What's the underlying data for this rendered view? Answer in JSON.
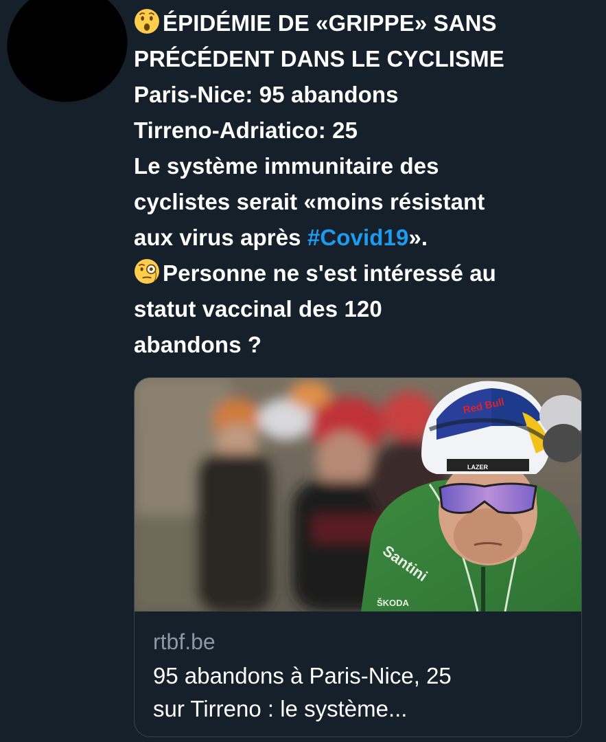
{
  "tweet": {
    "lines": [
      {
        "emoji": "hushed-face-emoji",
        "text": "ÉPIDÉMIE DE «GRIPPE» SANS"
      },
      {
        "text": "PRÉCÉDENT DANS LE CYCLISME"
      },
      {
        "text": "Paris-Nice: 95 abandons"
      },
      {
        "text": "Tirreno-Adriatico: 25"
      },
      {
        "text": "Le système immunitaire des"
      },
      {
        "text": "cyclistes serait «moins résistant"
      },
      {
        "text_before": "aux virus après ",
        "hashtag": "#Covid19",
        "text_after": "»."
      },
      {
        "emoji": "face-with-monocle-emoji",
        "text": "Personne ne s'est intéressé au"
      },
      {
        "text": "statut vaccinal des 120"
      },
      {
        "text": "abandons ?"
      }
    ]
  },
  "card": {
    "domain": "rtbf.be",
    "title_lines": [
      "95 abandons à Paris-Nice, 25",
      "sur Tirreno : le système..."
    ],
    "image_description_icon": "cyclist-photo",
    "image_logos": {
      "helmet": "Red Bull",
      "helmet_small": "LAZER",
      "jersey": "Santini",
      "sponsor": "ŠKODA"
    }
  },
  "colors": {
    "background": "#15202b",
    "text": "#ffffff",
    "hashtag": "#1d9bf0",
    "muted": "#8b98a5",
    "border": "#38444d"
  }
}
